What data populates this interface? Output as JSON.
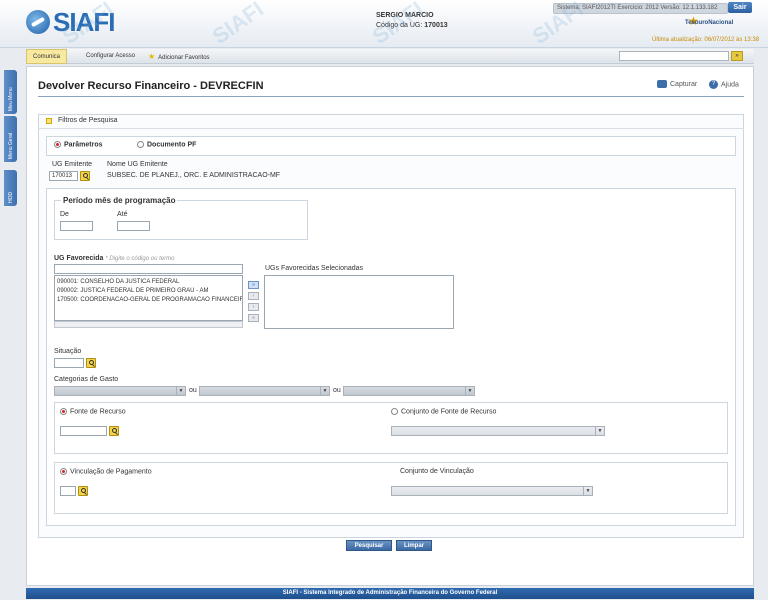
{
  "header": {
    "logo_text": "SIAFI",
    "user_name": "SERGIO MARCIO",
    "ug_label": "Código da UG:",
    "ug_code": "170013",
    "sysinfo": "Sistema: SIAFI2012TI  Exercício: 2012  Versão: 12.1.133.182",
    "logout_label": "Sair",
    "treasury_label": "TesouroNacional",
    "last_update": "Última atualização: 06/07/2012 às 13:38"
  },
  "menu": {
    "items": [
      {
        "label": "Comunica"
      },
      {
        "label": "Configurar Acesso"
      },
      {
        "label": "Adicionar Favoritos"
      }
    ],
    "search_go": "»"
  },
  "sidetabs": [
    "Meu Menu",
    "Menu Geral",
    "HOD"
  ],
  "page": {
    "title": "Devolver Recurso Financeiro - DEVRECFIN",
    "capture_label": "Capturar",
    "help_label": "Ajuda"
  },
  "filters": {
    "heading": "Filtros de Pesquisa",
    "mode_parametros": "Parâmetros",
    "mode_documento": "Documento PF",
    "ug_emitente_label": "UG Emitente",
    "ug_emitente_value": "170013",
    "nome_ug_label": "Nome UG Emitente",
    "nome_ug_value": "SUBSEC. DE PLANEJ., ORC. E ADMINISTRACAO-MF",
    "periodo_label": "Período mês de programação",
    "de_label": "De",
    "ate_label": "Até",
    "ug_favorecida_label": "UG Favorecida",
    "ug_favorecida_hint": "* Digite o código ou termo",
    "ug_favorecida_items": [
      "090001: CONSELHO DA JUSTICA FEDERAL",
      "090002: JUSTICA FEDERAL DE PRIMEIRO GRAU - AM",
      "170500: COORDENACAO-GERAL DE PROGRAMACAO FINANCEIRA"
    ],
    "ugs_selecionadas_label": "UGs Favorecidas Selecionadas",
    "move_buttons": [
      "»",
      "›",
      "‹",
      "«"
    ],
    "situacao_label": "Situação",
    "categorias_label": "Categorias de Gasto",
    "ou_label": "ou",
    "fonte_label": "Fonte de Recurso",
    "conjunto_fonte_label": "Conjunto de Fonte de Recurso",
    "vinculacao_label": "Vinculação de Pagamento",
    "conjunto_vinculacao_label": "Conjunto de Vinculação"
  },
  "actions": {
    "search_label": "Pesquisar",
    "clear_label": "Limpar"
  },
  "footer": {
    "text": "SIAFI - Sistema Integrado de Administração Financeira do Governo Federal"
  },
  "watermark": "SIAFI"
}
